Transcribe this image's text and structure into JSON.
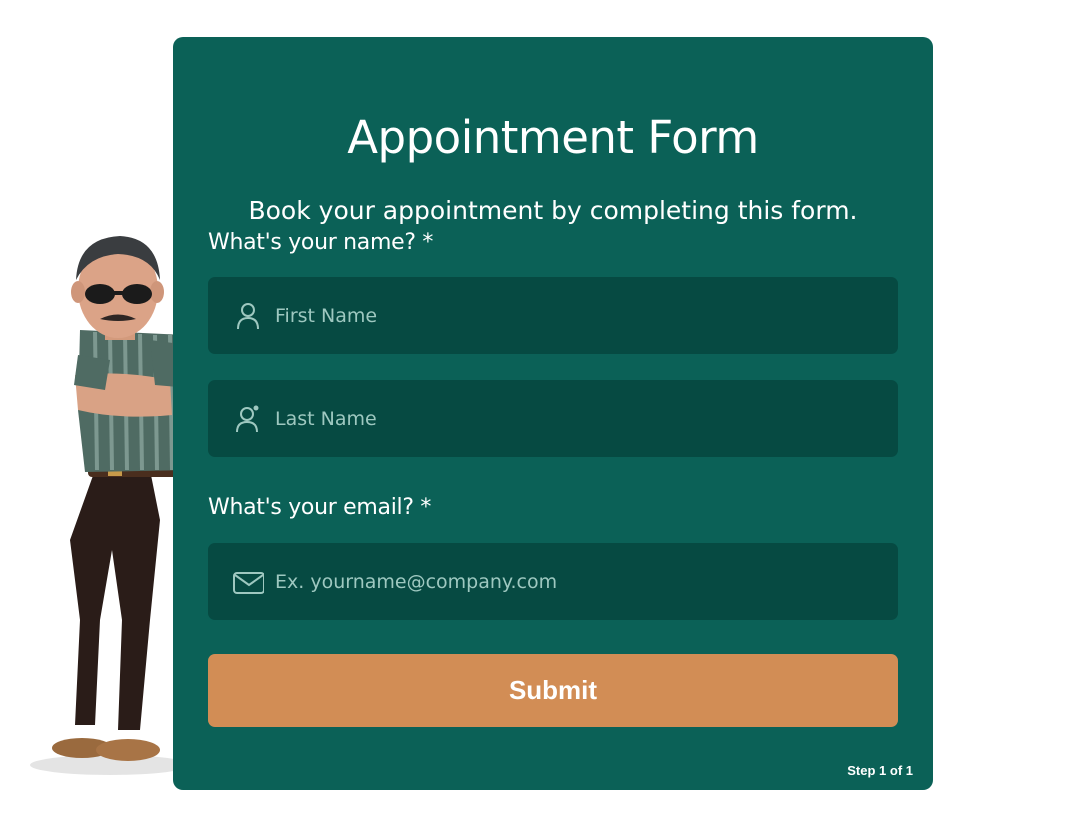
{
  "form": {
    "title": "Appointment Form",
    "subtitle": "Book your appointment by completing this form.",
    "name_label": "What's your name? *",
    "first_name_placeholder": "First Name",
    "last_name_placeholder": "Last Name",
    "email_label": "What's your email? *",
    "email_placeholder": "Ex. yourname@company.com",
    "submit_label": "Submit",
    "step_text": "Step 1 of 1"
  },
  "icons": {
    "first_name": "person-icon",
    "last_name": "person-add-icon",
    "email": "envelope-icon"
  },
  "colors": {
    "card_background": "#0b6157",
    "field_background": "#064a42",
    "button": "#d28d55",
    "text": "#ffffff",
    "placeholder": "#9ec8c0"
  }
}
